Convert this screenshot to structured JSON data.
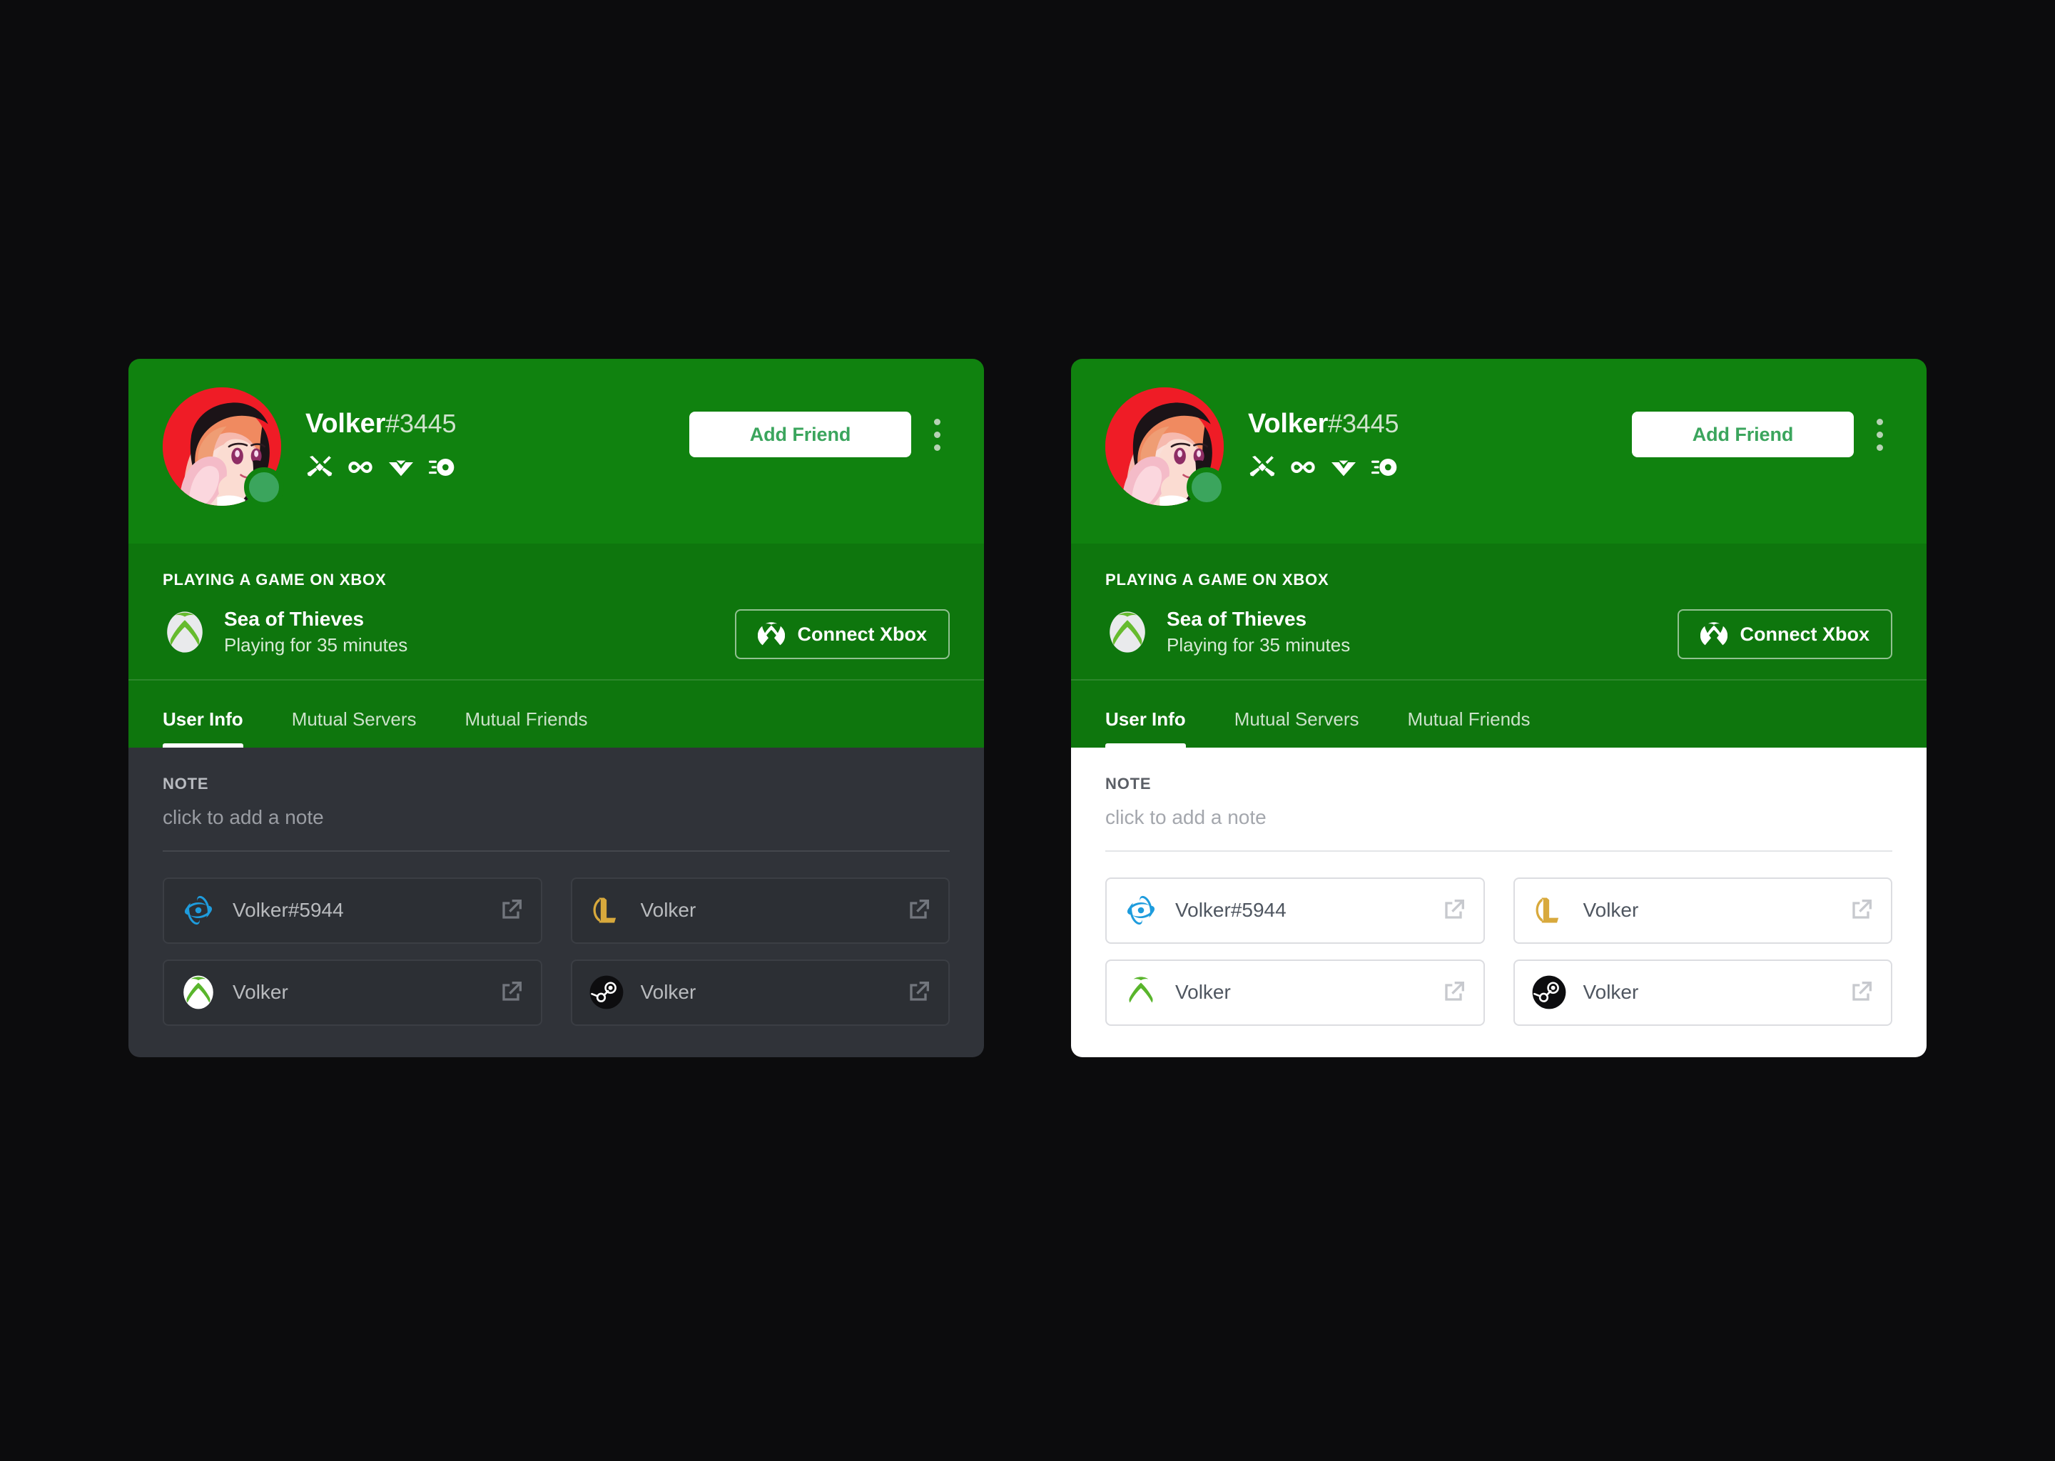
{
  "theme_colors": {
    "page_background": "#0c0c0d",
    "header_green": "#10820f",
    "activity_green": "#0e760d",
    "accent_green": "#3ba55d",
    "dark_body": "#303339",
    "dark_tile": "#2c2f34",
    "light_body": "#ffffff",
    "light_tile": "#ffffff",
    "avatar_background": "#ef1c26"
  },
  "profile": {
    "username": "Volker",
    "discriminator": "#3445",
    "status": "online",
    "avatar_alt": "anime-character-avatar",
    "badges": [
      {
        "name": "hypesquad-events-badge",
        "icon": "crossed-hammer-wrench-icon"
      },
      {
        "name": "nitro-badge",
        "icon": "infinity-icon"
      },
      {
        "name": "bug-hunter-badge",
        "icon": "chevron-wings-icon"
      },
      {
        "name": "active-developer-badge",
        "icon": "speeding-disc-icon"
      }
    ]
  },
  "header": {
    "add_friend_label": "Add Friend",
    "more_options_label": "More"
  },
  "activity": {
    "section_label": "PLAYING A GAME ON XBOX",
    "game_name": "Sea of Thieves",
    "game_detail": "Playing for 35 minutes",
    "game_logo": "xbox-icon",
    "connect_button_label": "Connect Xbox",
    "connect_button_icon": "xbox-icon"
  },
  "tabs": [
    {
      "id": "user-info",
      "label": "User Info",
      "active": true
    },
    {
      "id": "mutual-servers",
      "label": "Mutual Servers",
      "active": false
    },
    {
      "id": "mutual-friends",
      "label": "Mutual Friends",
      "active": false
    }
  ],
  "note": {
    "label": "NOTE",
    "value": "",
    "placeholder": "click to add a note"
  },
  "connections": [
    {
      "platform": "battlenet",
      "icon": "battlenet-icon",
      "name": "Volker#5944",
      "action_icon": "external-link-icon"
    },
    {
      "platform": "league-of-legends",
      "icon": "league-of-legends-icon",
      "name": "Volker",
      "action_icon": "external-link-icon"
    },
    {
      "platform": "xbox",
      "icon": "xbox-icon",
      "name": "Volker",
      "action_icon": "external-link-icon"
    },
    {
      "platform": "steam",
      "icon": "steam-icon",
      "name": "Volker",
      "action_icon": "external-link-icon"
    }
  ],
  "cards": [
    {
      "id": "dark-card",
      "theme": "dark"
    },
    {
      "id": "light-card",
      "theme": "light"
    }
  ]
}
